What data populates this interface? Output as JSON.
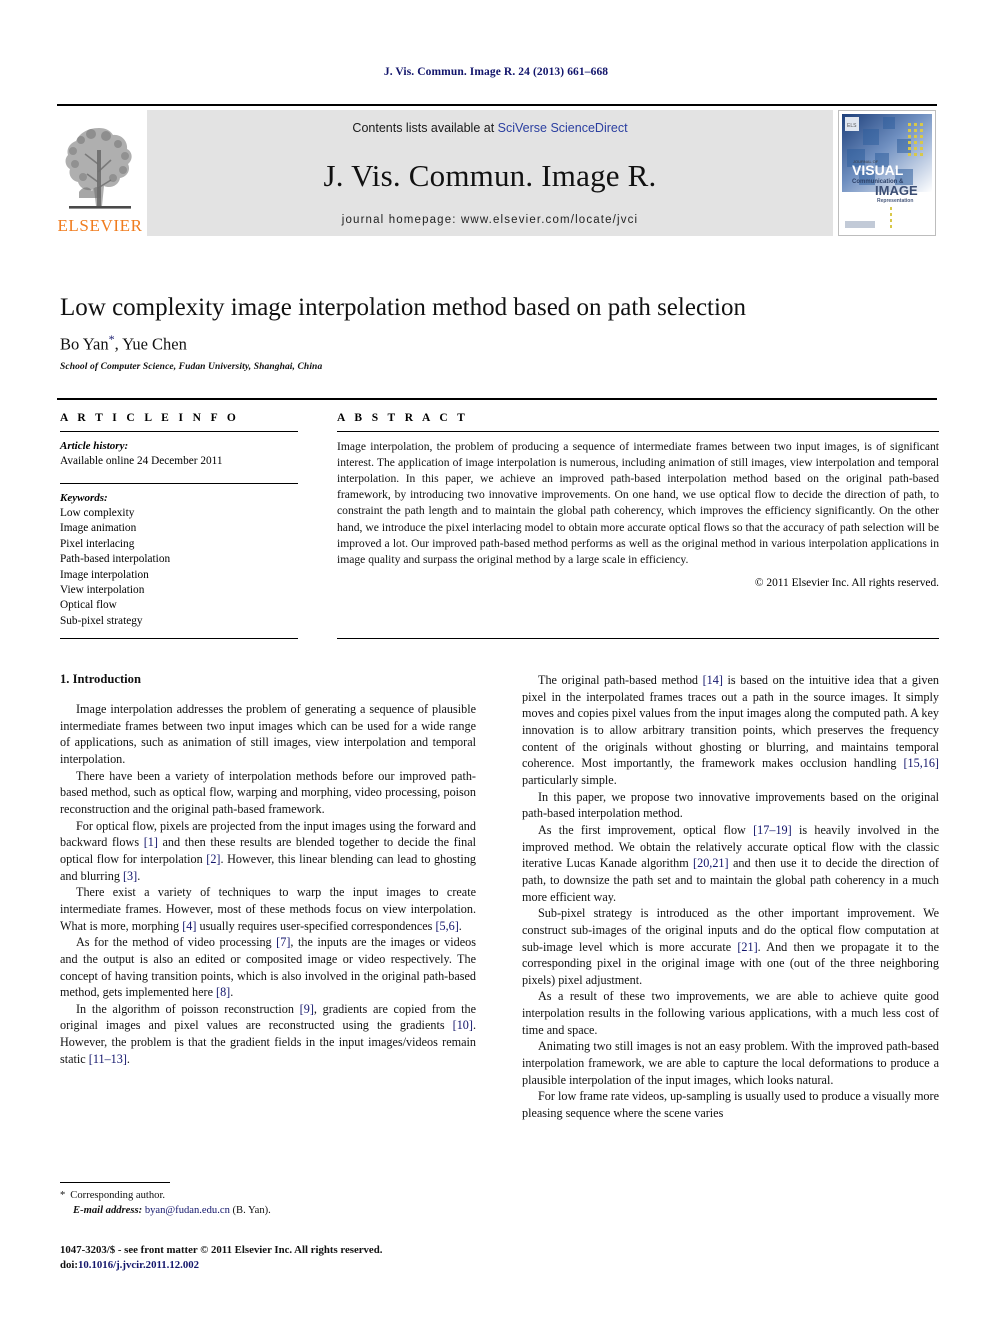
{
  "running_head": "J. Vis. Commun. Image R. 24 (2013) 661–668",
  "masthead": {
    "publisher_name": "ELSEVIER",
    "contents_prefix": "Contents lists available at ",
    "contents_link": "SciVerse ScienceDirect",
    "journal_title": "J. Vis. Commun. Image R.",
    "homepage": "journal homepage: www.elsevier.com/locate/jvci",
    "cover": {
      "line1": "JOURNAL OF",
      "line2": "VISUAL",
      "line3": "Communication &",
      "line4": "IMAGE",
      "line5": "Representation"
    }
  },
  "article": {
    "title": "Low complexity image interpolation method based on path selection",
    "authors": "Bo Yan",
    "corresponding_marker": "*",
    "authors_rest": ", Yue Chen",
    "affiliation": "School of Computer Science, Fudan University, Shanghai, China"
  },
  "info": {
    "heading": "A R T I C L E  I N F O",
    "history_label": "Article history:",
    "history_value": "Available online 24 December 2011",
    "keywords_label": "Keywords:",
    "keywords": [
      "Low complexity",
      "Image animation",
      "Pixel interlacing",
      "Path-based interpolation",
      "Image interpolation",
      "View interpolation",
      "Optical flow",
      "Sub-pixel strategy"
    ]
  },
  "abstract": {
    "heading": "A B S T R A C T",
    "text": "Image interpolation, the problem of producing a sequence of intermediate frames between two input images, is of significant interest. The application of image interpolation is numerous, including animation of still images, view interpolation and temporal interpolation. In this paper, we achieve an improved path-based interpolation method based on the original path-based framework, by introducing two innovative improvements. On one hand, we use optical flow to decide the direction of path, to constraint the path length and to maintain the global path coherency, which improves the efficiency significantly. On the other hand, we introduce the pixel interlacing model to obtain more accurate optical flows so that the accuracy of path selection will be improved a lot. Our improved path-based method performs as well as the original method in various interpolation applications in image quality and surpass the original method by a large scale in efficiency.",
    "copyright": "© 2011 Elsevier Inc. All rights reserved."
  },
  "body": {
    "section_heading": "1. Introduction",
    "left_paragraphs": [
      "Image interpolation addresses the problem of generating a sequence of plausible intermediate frames between two input images which can be used for a wide range of applications, such as animation of still images, view interpolation and temporal interpolation.",
      "There have been a variety of interpolation methods before our improved path-based method, such as optical flow, warping and morphing, video processing, poison reconstruction and the original path-based framework.",
      "For optical flow, pixels are projected from the input images using the forward and backward flows [1] and then these results are blended together to decide the final optical flow for interpolation [2]. However, this linear blending can lead to ghosting and blurring [3].",
      "There exist a variety of techniques to warp the input images to create intermediate frames. However, most of these methods focus on view interpolation. What is more, morphing [4] usually requires user-specified correspondences [5,6].",
      "As for the method of video processing [7], the inputs are the images or videos and the output is also an edited or composited image or video respectively. The concept of having transition points, which is also involved in the original path-based method, gets implemented here [8].",
      "In the algorithm of poisson reconstruction [9], gradients are copied from the original images and pixel values are reconstructed using the gradients [10]. However, the problem is that the gradient fields in the input images/videos remain static [11–13]."
    ],
    "right_paragraphs": [
      "The original path-based method [14] is based on the intuitive idea that a given pixel in the interpolated frames traces out a path in the source images. It simply moves and copies pixel values from the input images along the computed path. A key innovation is to allow arbitrary transition points, which preserves the frequency content of the originals without ghosting or blurring, and maintains temporal coherence. Most importantly, the framework makes occlusion handling [15,16] particularly simple.",
      "In this paper, we propose two innovative improvements based on the original path-based interpolation method.",
      "As the first improvement, optical flow [17–19] is heavily involved in the improved method. We obtain the relatively accurate optical flow with the classic iterative Lucas Kanade algorithm [20,21] and then use it to decide the direction of path, to downsize the path set and to maintain the global path coherency in a much more efficient way.",
      "Sub-pixel strategy is introduced as the other important improvement. We construct sub-images of the original inputs and do the optical flow computation at sub-image level which is more accurate [21]. And then we propagate it to the corresponding pixel in the original image with one (out of the three neighboring pixels) pixel adjustment.",
      "As a result of these two improvements, we are able to achieve quite good interpolation results in the following various applications, with a much less cost of time and space.",
      "Animating two still images is not an easy problem. With the improved path-based interpolation framework, we are able to capture the local deformations to produce a plausible interpolation of the input images, which looks natural.",
      "For low frame rate videos, up-sampling is usually used to produce a visually more pleasing sequence where the scene varies"
    ]
  },
  "footnote": {
    "star": "*",
    "corresponding": "Corresponding author.",
    "email_label": "E-mail address:",
    "email": "byan@fudan.edu.cn",
    "email_suffix": "(B. Yan)."
  },
  "imprint": {
    "issn_line": "1047-3203/$ - see front matter © 2011 Elsevier Inc. All rights reserved.",
    "doi_label": "doi:",
    "doi_value": "10.1016/j.jvcir.2011.12.002"
  },
  "colors": {
    "link_blue": "#12156b",
    "sciencedirect_blue": "#2b3fa0",
    "elsevier_orange": "#f07c1e",
    "masthead_gray": "#e3e3e3"
  }
}
